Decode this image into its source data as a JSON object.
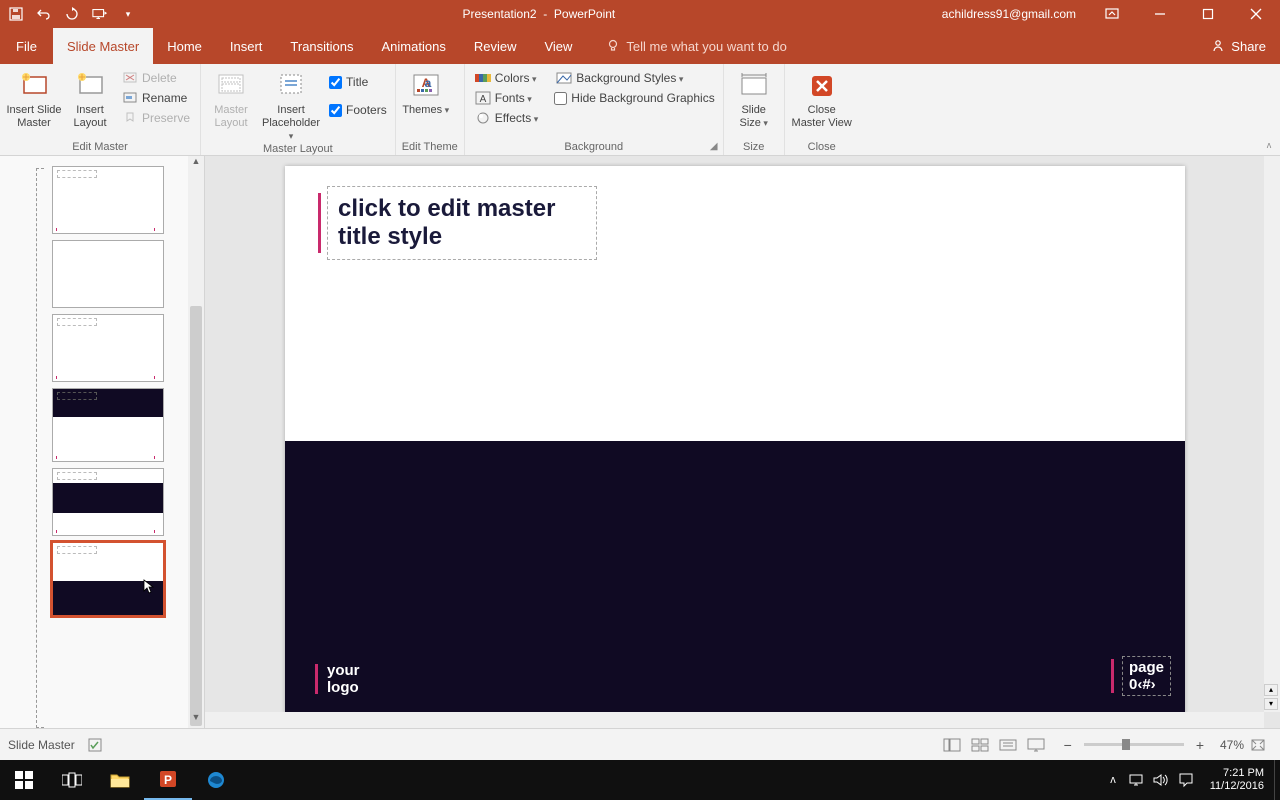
{
  "titlebar": {
    "title_doc": "Presentation2",
    "title_app": "PowerPoint",
    "user_email": "achildress91@gmail.com"
  },
  "tabs": {
    "file": "File",
    "slide_master": "Slide Master",
    "home": "Home",
    "insert": "Insert",
    "transitions": "Transitions",
    "animations": "Animations",
    "review": "Review",
    "view": "View",
    "tellme": "Tell me what you want to do",
    "share": "Share"
  },
  "ribbon": {
    "edit_master": {
      "insert_slide_master": "Insert Slide Master",
      "insert_layout": "Insert Layout",
      "delete": "Delete",
      "rename": "Rename",
      "preserve": "Preserve",
      "label": "Edit Master"
    },
    "master_layout": {
      "master_layout": "Master Layout",
      "insert_placeholder": "Insert Placeholder",
      "title": "Title",
      "footers": "Footers",
      "label": "Master Layout"
    },
    "edit_theme": {
      "themes": "Themes",
      "label": "Edit Theme"
    },
    "background": {
      "colors": "Colors",
      "fonts": "Fonts",
      "effects": "Effects",
      "bg_styles": "Background Styles",
      "hide_bg": "Hide Background Graphics",
      "label": "Background"
    },
    "size": {
      "slide_size": "Slide Size",
      "label": "Size"
    },
    "close": {
      "close_master": "Close Master View",
      "label": "Close"
    }
  },
  "slide": {
    "title_placeholder": "click to edit master title style",
    "logo_l1": "your",
    "logo_l2": "logo",
    "page_l1": "page",
    "page_l2": "0‹#›"
  },
  "statusbar": {
    "mode": "Slide Master",
    "zoom": "47%"
  },
  "taskbar": {
    "time": "7:21 PM",
    "date": "11/12/2016"
  }
}
